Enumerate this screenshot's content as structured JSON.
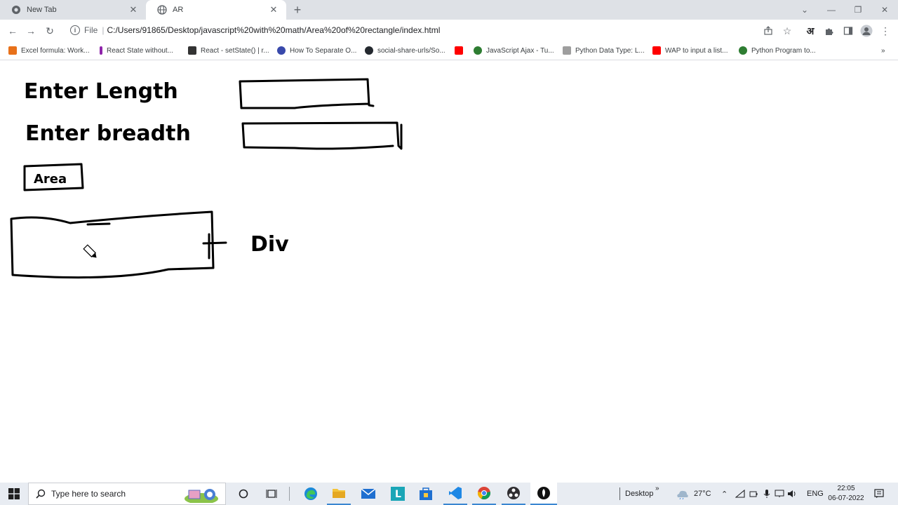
{
  "browser": {
    "tabs": [
      {
        "label": "New Tab",
        "active": false
      },
      {
        "label": "AR",
        "active": true
      }
    ],
    "new_tab_glyph": "+",
    "address": {
      "scheme": "File",
      "url": "C:/Users/91865/Desktop/javascript%20with%20math/Area%20of%20rectangle/index.html"
    },
    "toolbar_right": {
      "lang_glyph": "अ"
    },
    "bookmarks": [
      {
        "label": "Excel formula: Work...",
        "color": "#e8711a"
      },
      {
        "label": "React State without...",
        "color": "#8e24aa"
      },
      {
        "label": "React - setState() | r...",
        "color": "#333333"
      },
      {
        "label": "How To Separate O...",
        "color": "#3949ab"
      },
      {
        "label": "social-share-urls/So...",
        "color": "#24292f"
      },
      {
        "label": "",
        "color": "#ff0000"
      },
      {
        "label": "JavaScript Ajax - Tu...",
        "color": "#2e7d32"
      },
      {
        "label": "Python Data Type: L...",
        "color": "#9e9e9e"
      },
      {
        "label": "WAP to input a list...",
        "color": "#ff0000"
      },
      {
        "label": "Python Program to...",
        "color": "#2e7d32"
      }
    ]
  },
  "sketch": {
    "label_length": "Enter Length",
    "label_breadth": "Enter breadth",
    "button_area": "Area",
    "label_div": "Div"
  },
  "taskbar": {
    "search_placeholder": "Type here to search",
    "desktop_label": "Desktop",
    "temperature": "27°C",
    "language": "ENG",
    "time": "22:05",
    "date": "06-07-2022"
  }
}
